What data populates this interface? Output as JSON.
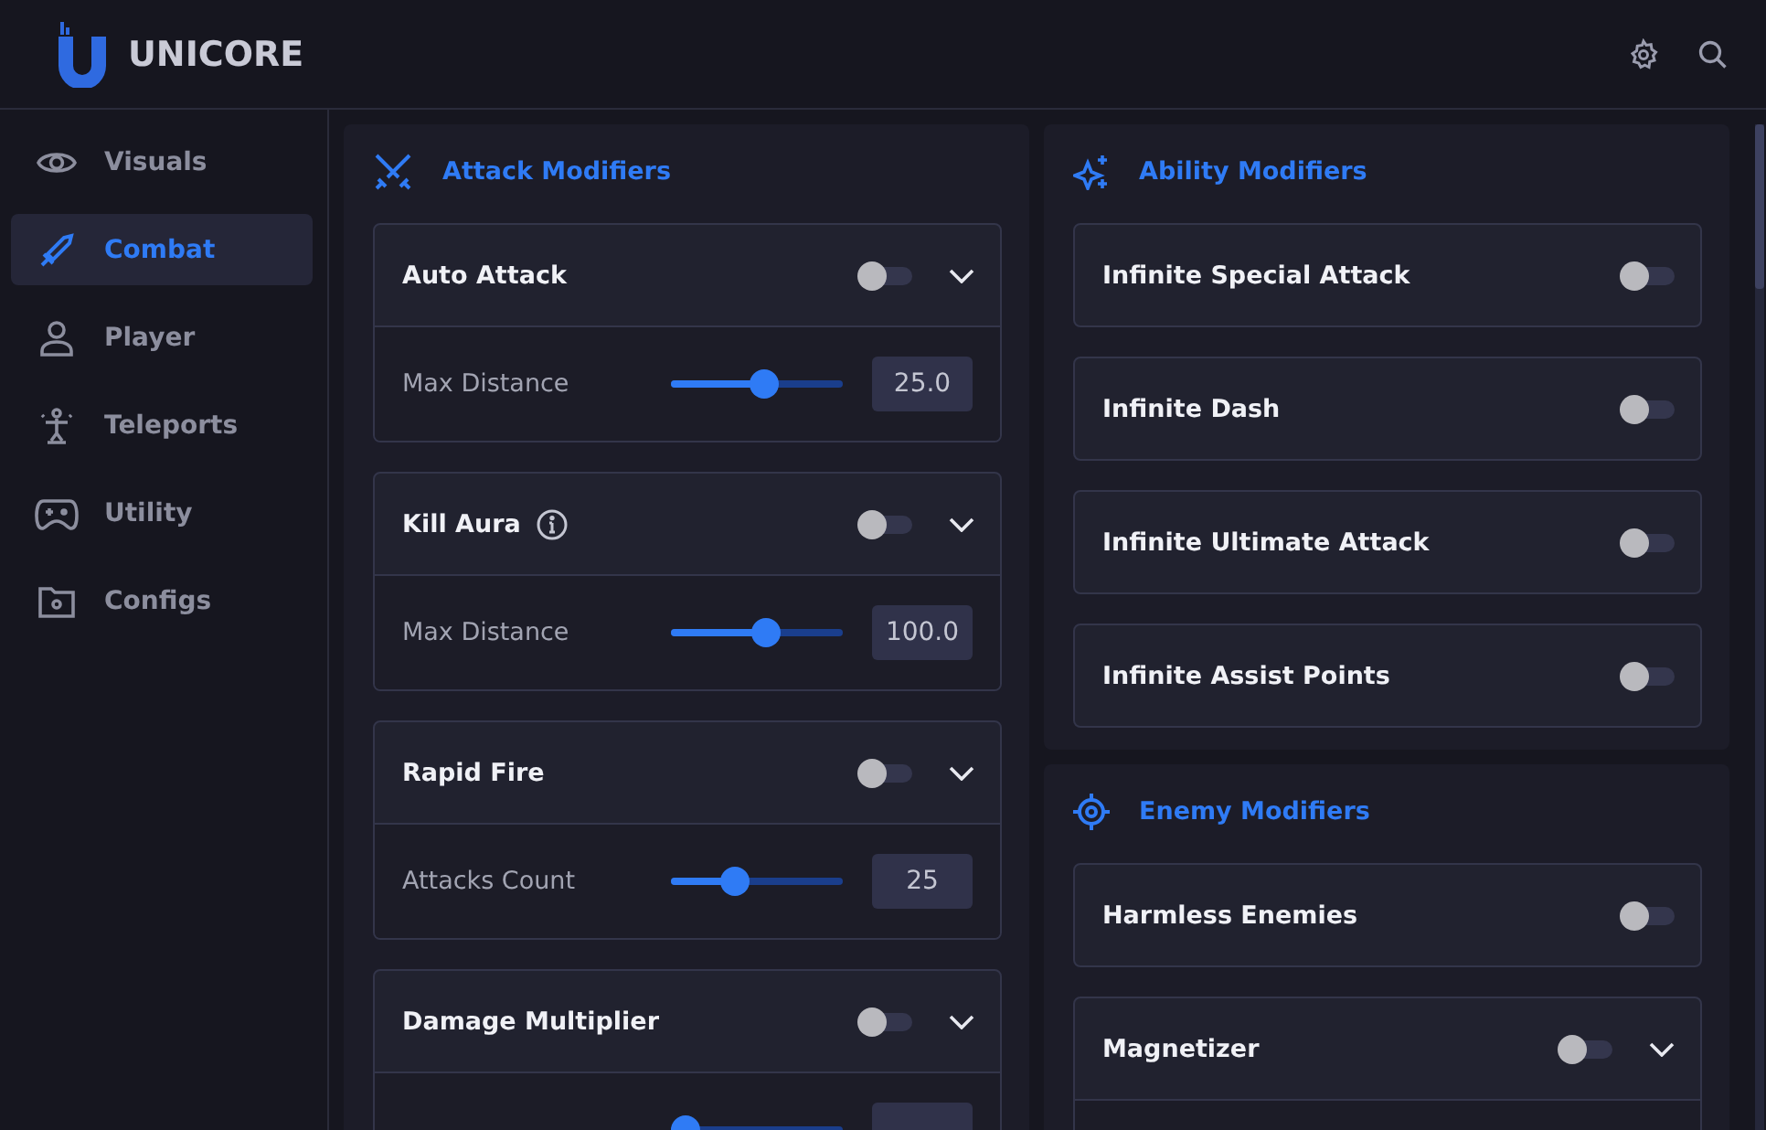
{
  "app": {
    "name": "UNICORE"
  },
  "header_actions": [
    {
      "kind": "settings"
    },
    {
      "kind": "search"
    }
  ],
  "sidebar": {
    "items": [
      {
        "label": "Visuals",
        "selected": false
      },
      {
        "label": "Combat",
        "selected": true
      },
      {
        "label": "Player",
        "selected": false
      },
      {
        "label": "Teleports",
        "selected": false
      },
      {
        "label": "Utility",
        "selected": false
      },
      {
        "label": "Configs",
        "selected": false
      }
    ]
  },
  "columns": [
    [
      {
        "title": "Attack Modifiers",
        "cards": [
          {
            "title": "Auto Attack",
            "info": false,
            "on": false,
            "expanded": true,
            "settings": [
              {
                "label": "Max Distance",
                "level": 0.49,
                "value": "25.0"
              }
            ]
          },
          {
            "title": "Kill Aura",
            "info": true,
            "on": false,
            "expanded": true,
            "settings": [
              {
                "label": "Max Distance",
                "level": 0.5,
                "value": "100.0"
              }
            ]
          },
          {
            "title": "Rapid Fire",
            "info": false,
            "on": false,
            "expanded": true,
            "settings": [
              {
                "label": "Attacks Count",
                "level": 0.34,
                "value": "25"
              }
            ]
          },
          {
            "title": "Damage Multiplier",
            "info": false,
            "on": false,
            "expanded": true,
            "settings": [
              {
                "level": 0.08
              }
            ]
          }
        ]
      }
    ],
    [
      {
        "title": "Ability Modifiers",
        "cards": [
          {
            "title": "Infinite Special Attack",
            "info": false,
            "on": false
          },
          {
            "title": "Infinite Dash",
            "info": false,
            "on": false
          },
          {
            "title": "Infinite Ultimate Attack",
            "info": false,
            "on": false
          },
          {
            "title": "Infinite Assist Points",
            "info": false,
            "on": false
          }
        ]
      },
      {
        "title": "Enemy Modifiers",
        "cards": [
          {
            "title": "Harmless Enemies",
            "info": false,
            "on": false
          },
          {
            "title": "Magnetizer",
            "info": false,
            "on": false,
            "expanded": true
          }
        ]
      }
    ]
  ]
}
